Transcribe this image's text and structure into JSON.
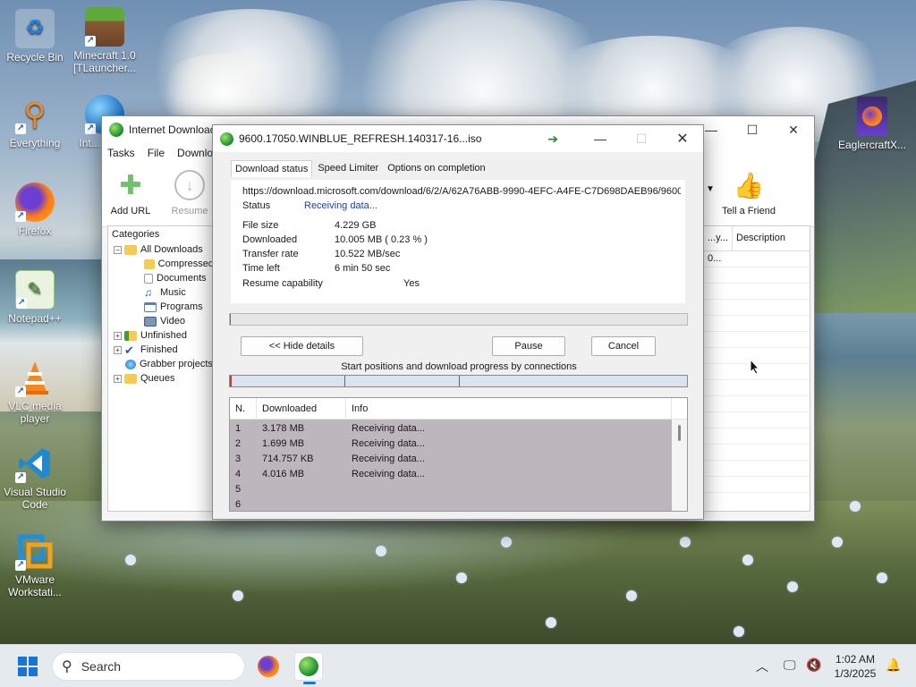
{
  "desktop": {
    "icons": [
      {
        "label": "Recycle Bin"
      },
      {
        "label": "Minecraft 1.0 [TLauncher..."
      },
      {
        "label": "Everything"
      },
      {
        "label": "Int... Dov..."
      },
      {
        "label": "Firefox"
      },
      {
        "label": "Notepad++"
      },
      {
        "label": "VLC media player"
      },
      {
        "label": "Visual Studio Code"
      },
      {
        "label": "VMware Workstati..."
      },
      {
        "label": "EaglercraftX..."
      }
    ]
  },
  "main_window": {
    "title": "Internet Download Manager",
    "menu": [
      "Tasks",
      "File",
      "Downlo..."
    ],
    "toolbar": {
      "add_url": "Add URL",
      "resume": "Resume",
      "tell_friend": "Tell a Friend"
    },
    "categories_title": "Categories",
    "tree": [
      {
        "label": "All Downloads",
        "expander": "−"
      },
      {
        "label": "Compressed"
      },
      {
        "label": "Documents"
      },
      {
        "label": "Music"
      },
      {
        "label": "Programs"
      },
      {
        "label": "Video"
      },
      {
        "label": "Unfinished",
        "expander": "+"
      },
      {
        "label": "Finished",
        "expander": "+"
      },
      {
        "label": "Grabber projects"
      },
      {
        "label": "Queues",
        "expander": "+"
      }
    ],
    "list_columns": {
      "partial": "...y...",
      "description": "Description"
    },
    "list_first_row": "0..."
  },
  "dialog": {
    "title": "9600.17050.WINBLUE_REFRESH.140317-16...iso",
    "tabs": [
      "Download status",
      "Speed Limiter",
      "Options on completion"
    ],
    "url": "https://download.microsoft.com/download/6/2/A/62A76ABB-9990-4EFC-A4FE-C7D698DAEB96/9600",
    "status_label": "Status",
    "status_value": "Receiving data...",
    "rows": [
      {
        "label": "File size",
        "value": "4.229  GB"
      },
      {
        "label": "Downloaded",
        "value": "10.005  MB  ( 0.23 % )"
      },
      {
        "label": "Transfer rate",
        "value": "10.522  MB/sec"
      },
      {
        "label": "Time left",
        "value": "6 min 50 sec"
      }
    ],
    "resume_label": "Resume capability",
    "resume_value": "Yes",
    "progress_percent": 0.23,
    "buttons": {
      "hide_details": "<< Hide details",
      "pause": "Pause",
      "cancel": "Cancel"
    },
    "connections_label": "Start positions and download progress by connections",
    "table_headers": {
      "n": "N.",
      "downloaded": "Downloaded",
      "info": "Info"
    },
    "connections": [
      {
        "n": "1",
        "downloaded": "3.178  MB",
        "info": "Receiving data..."
      },
      {
        "n": "2",
        "downloaded": "1.699  MB",
        "info": "Receiving data..."
      },
      {
        "n": "3",
        "downloaded": "714.757  KB",
        "info": "Receiving data..."
      },
      {
        "n": "4",
        "downloaded": "4.016  MB",
        "info": "Receiving data..."
      },
      {
        "n": "5",
        "downloaded": "",
        "info": ""
      },
      {
        "n": "6",
        "downloaded": "",
        "info": ""
      }
    ]
  },
  "taskbar": {
    "search_placeholder": "Search",
    "time": "1:02 AM",
    "date": "1/3/2025"
  },
  "colors": {
    "accent": "#1a74d8",
    "status_link": "#1d3fa8",
    "progress_fill": "#06b025",
    "connection_marker": "#c43c3c"
  }
}
